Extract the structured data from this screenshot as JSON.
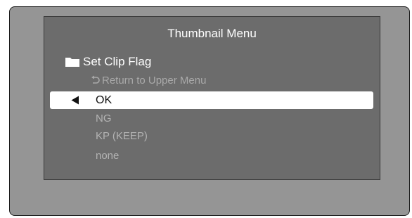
{
  "menu": {
    "title": "Thumbnail Menu",
    "folder_label": "Set Clip Flag",
    "return_label": "Return to Upper Menu",
    "options": [
      {
        "label": "OK",
        "selected": true
      },
      {
        "label": "NG",
        "selected": false
      },
      {
        "label": "KP (KEEP)",
        "selected": false
      },
      {
        "label": "none",
        "selected": false
      }
    ]
  },
  "icons": {
    "folder": "folder-icon",
    "return": "return-arrow-icon",
    "cursor": "selection-cursor-icon"
  },
  "colors": {
    "frame_bg": "#959595",
    "panel_bg": "#6c6c6c",
    "selection_bg": "#ffffff",
    "active_text": "#ffffff",
    "inactive_text": "#b3b3b3"
  }
}
